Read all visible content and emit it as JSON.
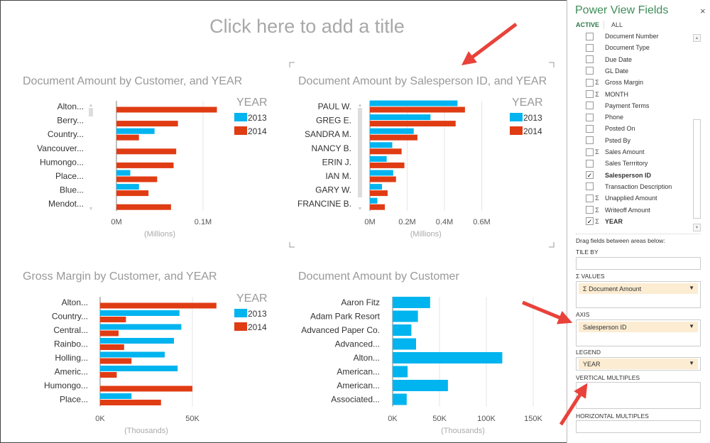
{
  "page": {
    "title_placeholder": "Click here to add a title"
  },
  "colors": {
    "series_2013": "#00b4ef",
    "series_2014": "#e03c14",
    "panel_title": "#3f8d5a",
    "arrow": "#e8423a",
    "chip": "#fcecd2"
  },
  "charts": [
    {
      "id": "customer-year",
      "title": "Document Amount by Customer, and YEAR",
      "type": "bar",
      "legend_title": "YEAR",
      "categories": [
        "Alton...",
        "Berry...",
        "Country...",
        "Vancouver...",
        "Humongo...",
        "Place...",
        "Blue...",
        "Mendot..."
      ],
      "series": [
        {
          "name": "2013",
          "values": [
            0,
            0,
            0.044,
            0,
            0,
            0.016,
            0.026,
            0
          ]
        },
        {
          "name": "2014",
          "values": [
            0.116,
            0.071,
            0.026,
            0.069,
            0.066,
            0.047,
            0.037,
            0.063
          ]
        }
      ],
      "ticks": [
        {
          "v": 0,
          "label": "0M"
        },
        {
          "v": 0.1,
          "label": "0.1M"
        }
      ],
      "xlabel": "(Millions)",
      "grid": true,
      "legend": "top-right"
    },
    {
      "id": "salesperson-year",
      "title": "Document Amount by Salesperson ID, and YEAR",
      "type": "bar",
      "legend_title": "YEAR",
      "categories": [
        "PAUL W.",
        "GREG E.",
        "SANDRA M.",
        "NANCY B.",
        "ERIN J.",
        "IAN M.",
        "GARY W.",
        "FRANCINE B."
      ],
      "series": [
        {
          "name": "2013",
          "values": [
            0.47,
            0.325,
            0.235,
            0.12,
            0.09,
            0.125,
            0.065,
            0.04
          ]
        },
        {
          "name": "2014",
          "values": [
            0.51,
            0.46,
            0.255,
            0.17,
            0.185,
            0.14,
            0.095,
            0.08
          ]
        }
      ],
      "ticks": [
        {
          "v": 0,
          "label": "0M"
        },
        {
          "v": 0.2,
          "label": "0.2M"
        },
        {
          "v": 0.4,
          "label": "0.4M"
        },
        {
          "v": 0.6,
          "label": "0.6M"
        }
      ],
      "xlabel": "(Millions)",
      "grid": true,
      "legend": "top-right"
    },
    {
      "id": "gross-margin-year",
      "title": "Gross Margin by Customer, and YEAR",
      "type": "bar",
      "legend_title": "YEAR",
      "categories": [
        "Alton...",
        "Country...",
        "Central...",
        "Rainbo...",
        "Holling...",
        "Americ...",
        "Humongo...",
        "Place..."
      ],
      "series": [
        {
          "name": "2013",
          "values": [
            0,
            43,
            44,
            40,
            35,
            42,
            0,
            17
          ]
        },
        {
          "name": "2014",
          "values": [
            63,
            14,
            10,
            13,
            17,
            9,
            50,
            33
          ]
        }
      ],
      "ticks": [
        {
          "v": 0,
          "label": "0K"
        },
        {
          "v": 50,
          "label": "50K"
        }
      ],
      "xlabel": "(Thousands)",
      "grid": true,
      "legend": "top-right"
    },
    {
      "id": "customer",
      "title": "Document Amount by Customer",
      "type": "bar",
      "legend_title": "",
      "categories": [
        "Aaron Fitz",
        "Adam Park Resort",
        "Advanced Paper Co.",
        "Advanced...",
        "Alton...",
        "American...",
        "American...",
        "Associated..."
      ],
      "series": [
        {
          "values": [
            40,
            27,
            20,
            25,
            117,
            16,
            59,
            15
          ]
        }
      ],
      "ticks": [
        {
          "v": 0,
          "label": "0K"
        },
        {
          "v": 50,
          "label": "50K"
        },
        {
          "v": 100,
          "label": "100K"
        },
        {
          "v": 150,
          "label": "150K"
        }
      ],
      "xlabel": "(Thousands)",
      "grid": true,
      "legend": "none"
    }
  ],
  "panel": {
    "title": "Power View Fields",
    "close": "×",
    "tabs": [
      {
        "label": "ACTIVE",
        "active": true
      },
      {
        "label": "ALL",
        "active": false
      }
    ],
    "fields": [
      {
        "label": "Document Number",
        "sigma": false,
        "checked": false
      },
      {
        "label": "Document Type",
        "sigma": false,
        "checked": false
      },
      {
        "label": "Due Date",
        "sigma": false,
        "checked": false
      },
      {
        "label": "GL Date",
        "sigma": false,
        "checked": false
      },
      {
        "label": "Gross Margin",
        "sigma": true,
        "checked": false
      },
      {
        "label": "MONTH",
        "sigma": true,
        "checked": false
      },
      {
        "label": "Payment Terms",
        "sigma": false,
        "checked": false
      },
      {
        "label": "Phone",
        "sigma": false,
        "checked": false
      },
      {
        "label": "Posted On",
        "sigma": false,
        "checked": false
      },
      {
        "label": "Psted By",
        "sigma": false,
        "checked": false
      },
      {
        "label": "Sales Amount",
        "sigma": true,
        "checked": false
      },
      {
        "label": "Sales Terrritory",
        "sigma": false,
        "checked": false
      },
      {
        "label": "Salesperson ID",
        "sigma": false,
        "checked": true
      },
      {
        "label": "Transaction Description",
        "sigma": false,
        "checked": false
      },
      {
        "label": "Unapplied Amount",
        "sigma": true,
        "checked": false
      },
      {
        "label": "Writeoff Amount",
        "sigma": true,
        "checked": false
      },
      {
        "label": "YEAR",
        "sigma": true,
        "checked": true
      }
    ],
    "sigma_glyph": "Σ",
    "check_glyph": "✓",
    "drag_hint": "Drag fields between areas below:",
    "areas": {
      "tile_by": {
        "label": "TILE BY"
      },
      "values": {
        "label": "Σ VALUES",
        "chip": "Σ Document Amount"
      },
      "axis": {
        "label": "AXIS",
        "chip": "Salesperson ID"
      },
      "legend": {
        "label": "LEGEND",
        "chip": "YEAR"
      },
      "vertical_multiples": {
        "label": "VERTICAL MULTIPLES"
      },
      "horizontal_multiples": {
        "label": "HORIZONTAL MULTIPLES"
      }
    },
    "dropdown_glyph": "▼"
  }
}
